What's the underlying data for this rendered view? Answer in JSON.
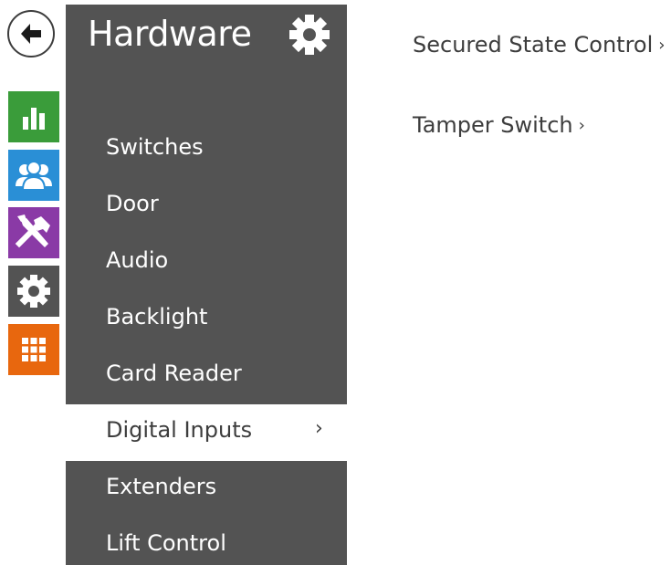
{
  "back": {
    "icon": "back-arrow-icon"
  },
  "rail": [
    {
      "name": "status",
      "icon": "bar-chart-icon",
      "color": "#3a9c3a"
    },
    {
      "name": "directory",
      "icon": "users-icon",
      "color": "#2a8fd6"
    },
    {
      "name": "services",
      "icon": "tools-icon",
      "color": "#8a3aa6"
    },
    {
      "name": "hardware",
      "icon": "gear-icon",
      "color": "#535353"
    },
    {
      "name": "system",
      "icon": "grid-icon",
      "color": "#e8670e"
    }
  ],
  "sidebar": {
    "title": "Hardware",
    "title_icon": "gear-icon",
    "items": [
      {
        "label": "Switches"
      },
      {
        "label": "Door"
      },
      {
        "label": "Audio"
      },
      {
        "label": "Backlight"
      },
      {
        "label": "Card Reader"
      },
      {
        "label": "Digital Inputs",
        "active": true,
        "chevron": "›"
      },
      {
        "label": "Extenders"
      },
      {
        "label": "Lift Control"
      }
    ]
  },
  "content": {
    "links": [
      {
        "label": "Secured State Control",
        "chevron": "›"
      },
      {
        "label": "Tamper Switch",
        "chevron": "›"
      }
    ]
  },
  "colors": {
    "sidebar_bg": "#535353",
    "text_dark": "#3d3d3d",
    "white": "#ffffff"
  }
}
